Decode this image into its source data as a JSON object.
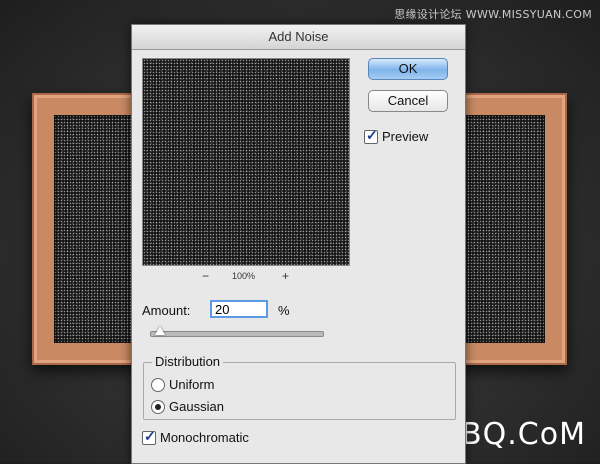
{
  "dialog": {
    "title": "Add Noise",
    "ok_label": "OK",
    "cancel_label": "Cancel",
    "preview_label": "Preview",
    "preview_checked": true,
    "zoom": {
      "minus": "−",
      "level": "100%",
      "plus": "+"
    },
    "amount": {
      "label": "Amount:",
      "value": "20",
      "unit": "%",
      "fraction": 0.05
    },
    "distribution": {
      "label": "Distribution",
      "options": [
        {
          "label": "Uniform",
          "selected": false
        },
        {
          "label": "Gaussian",
          "selected": true
        }
      ]
    },
    "monochromatic": {
      "label": "Monochromatic",
      "checked": true
    }
  },
  "watermarks": {
    "top": "思缘设计论坛 WWW.MISSYUAN.COM",
    "bottom": "UiBQ.CoM"
  },
  "colors": {
    "frame": "#c98a63",
    "ok_button": "#7fb4ea",
    "dialog_bg": "#e8e8e8"
  }
}
